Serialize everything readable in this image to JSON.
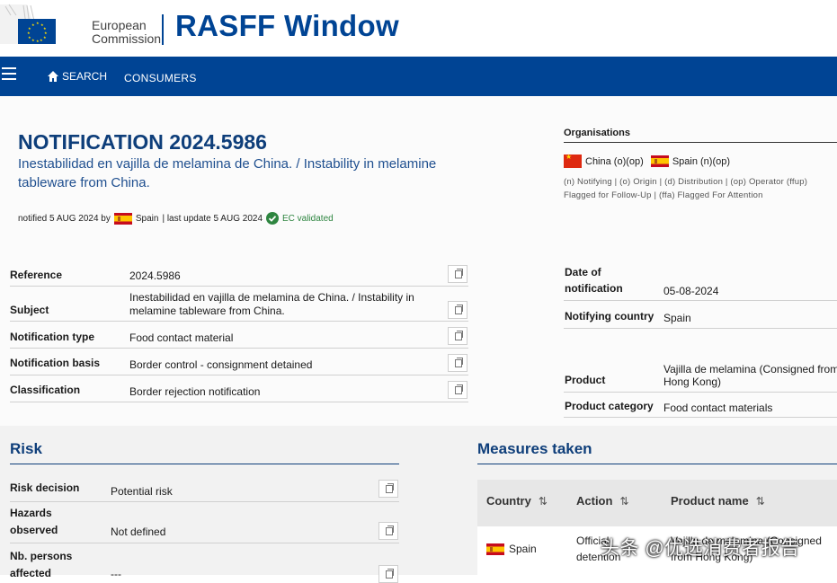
{
  "header": {
    "org_line1": "European",
    "org_line2": "Commission",
    "title": "RASFF Window",
    "brand_color": "#004494"
  },
  "nav": {
    "search_label": "SEARCH",
    "consumers_label": "CONSUMERS"
  },
  "notification": {
    "title": "NOTIFICATION 2024.5986",
    "subtitle": "Inestabilidad en vajilla de melamina de China. / Instability in melamine tableware from China.",
    "meta_prefix": "notified 5 AUG 2024 by",
    "meta_country": "Spain",
    "meta_update": "| last update 5 AUG 2024",
    "validated": "EC validated"
  },
  "organisations": {
    "title": "Organisations",
    "china": "China (o)(op)",
    "spain": "Spain (n)(op)",
    "legend": "(n) Notifying | (o) Origin | (d) Distribution | (op) Operator (ffup) Flagged for Follow-Up | (ffa) Flagged For Attention"
  },
  "details": [
    {
      "label": "Reference",
      "value": "2024.5986"
    },
    {
      "label": "Subject",
      "value": "Inestabilidad en vajilla de melamina de China. / Instability in melamine tableware from China."
    },
    {
      "label": "Notification type",
      "value": "Food contact material"
    },
    {
      "label": "Notification basis",
      "value": "Border control - consignment detained"
    },
    {
      "label": "Classification",
      "value": "Border rejection notification"
    }
  ],
  "right_details": [
    {
      "label": "Date of notification",
      "value": "05-08-2024"
    },
    {
      "label": "Notifying country",
      "value": "Spain"
    },
    {
      "label": "Product",
      "value": "Vajilla de melamina (Consigned from Hong Kong)"
    },
    {
      "label": "Product category",
      "value": "Food contact materials"
    }
  ],
  "risk": {
    "title": "Risk",
    "rows": [
      {
        "label": "Risk decision",
        "value": "Potential risk"
      },
      {
        "label": "Hazards observed",
        "value": "Not defined"
      },
      {
        "label": "Nb. persons affected",
        "value": "---"
      }
    ]
  },
  "measures": {
    "title": "Measures taken",
    "headers": [
      "Country",
      "Action",
      "Product name"
    ],
    "sort_glyph": "⇅",
    "row": {
      "country": "Spain",
      "action": "Official detention",
      "product": "Vajilla de melamina (Consigned from Hong Kong)"
    }
  },
  "watermark": "头条 @优选消费者报告"
}
